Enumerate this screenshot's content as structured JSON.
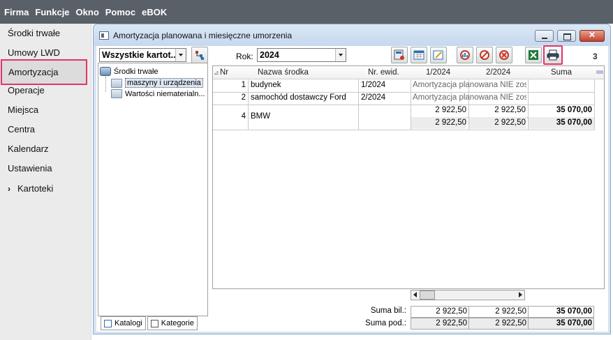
{
  "menu": [
    "Firma",
    "Funkcje",
    "Okno",
    "Pomoc",
    "eBOK"
  ],
  "sidebar": {
    "items": [
      {
        "label": "Środki trwałe"
      },
      {
        "label": "Umowy LWD"
      },
      {
        "label": "Amortyzacja"
      },
      {
        "label": "Operacje"
      },
      {
        "label": "Miejsca"
      },
      {
        "label": "Centra"
      },
      {
        "label": "Kalendarz"
      },
      {
        "label": "Ustawienia"
      },
      {
        "label": "Kartoteki"
      }
    ],
    "chevron": "›"
  },
  "window": {
    "title": "Amortyzacja planowana i miesięczne umorzenia",
    "close_glyph": "✕"
  },
  "filter": {
    "value": "Wszystkie kartot..."
  },
  "tree": {
    "root": "Środki trwałe",
    "children": [
      "maszyny i urządzenia",
      "Wartości niematerialn..."
    ]
  },
  "tabs": {
    "katalogi": "Katalogi",
    "kategorie": "Kategorie"
  },
  "toolbar": {
    "rok_label": "Rok:",
    "rok_value": "2024",
    "count": "3"
  },
  "grid": {
    "headers": {
      "nr": "Nr",
      "nazwa": "Nazwa środka",
      "ewid": "Nr. ewid.",
      "m1": "1/2024",
      "m2": "2/2024",
      "suma": "Suma",
      "sort": "⊿"
    },
    "rows": [
      {
        "nr": "1",
        "nazwa": "budynek",
        "ewid": "1/2024",
        "note": "Amortyzacja planowana NIE została"
      },
      {
        "nr": "2",
        "nazwa": "samochód dostawczy Ford",
        "ewid": "2/2024",
        "note": "Amortyzacja planowana NIE została"
      },
      {
        "nr": "4",
        "nazwa": "BMW",
        "ewid": "",
        "bil1": "2 922,50",
        "bil2": "2 922,50",
        "bil_suma": "35 070,00",
        "pod1": "2 922,50",
        "pod2": "2 922,50",
        "pod_suma": "35 070,00"
      }
    ]
  },
  "summary": {
    "bil_label": "Suma bil.:",
    "pod_label": "Suma pod.:",
    "bil": [
      "2 922,50",
      "2 922,50",
      "35 070,00"
    ],
    "pod": [
      "2 922,50",
      "2 922,50",
      "35 070,00"
    ]
  },
  "colors": {
    "highlight": "#e0356b",
    "menubar": "#5a6068"
  }
}
